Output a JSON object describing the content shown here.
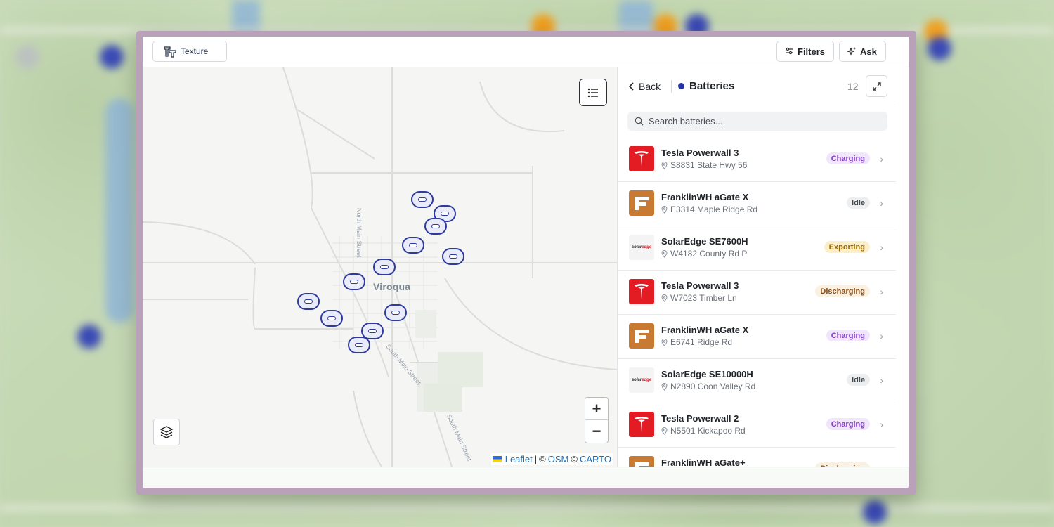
{
  "app": {
    "logo_label": "Texture",
    "filters_label": "Filters",
    "ask_label": "Ask"
  },
  "map": {
    "town": "Viroqua",
    "streets": [
      "North Main Street",
      "South Main Street",
      "South Main Street"
    ],
    "attribution": {
      "leaflet": "Leaflet",
      "sep": "|",
      "c1": "©",
      "osm": "OSM",
      "c2": "©",
      "carto": "CARTO"
    },
    "zoom_in": "+",
    "zoom_out": "−",
    "marker_count": 13
  },
  "panel": {
    "back_label": "Back",
    "title": "Batteries",
    "count": "12",
    "search_placeholder": "Search batteries...",
    "items": [
      {
        "name": "Tesla Powerwall 3",
        "address": "S8831 State Hwy 56",
        "status": "Charging",
        "brand": "tesla"
      },
      {
        "name": "FranklinWH aGate X",
        "address": "E3314 Maple Ridge Rd",
        "status": "Idle",
        "brand": "franklin"
      },
      {
        "name": "SolarEdge SE7600H",
        "address": "W4182 County Rd P",
        "status": "Exporting",
        "brand": "solaredge"
      },
      {
        "name": "Tesla Powerwall 3",
        "address": "W7023 Timber Ln",
        "status": "Discharging",
        "brand": "tesla"
      },
      {
        "name": "FranklinWH aGate X",
        "address": "E6741 Ridge Rd",
        "status": "Charging",
        "brand": "franklin"
      },
      {
        "name": "SolarEdge SE10000H",
        "address": "N2890 Coon Valley Rd",
        "status": "Idle",
        "brand": "solaredge"
      },
      {
        "name": "Tesla Powerwall 2",
        "address": "N5501 Kickapoo Rd",
        "status": "Charging",
        "brand": "tesla"
      },
      {
        "name": "FranklinWH aGate+",
        "address": "",
        "status": "Discharging",
        "brand": "franklin"
      }
    ]
  },
  "brand_logo_text": {
    "solaredge": "solaredge"
  },
  "colors": {
    "accent": "#2433a6",
    "tesla": "#e31b23",
    "franklin": "#c97a32"
  }
}
